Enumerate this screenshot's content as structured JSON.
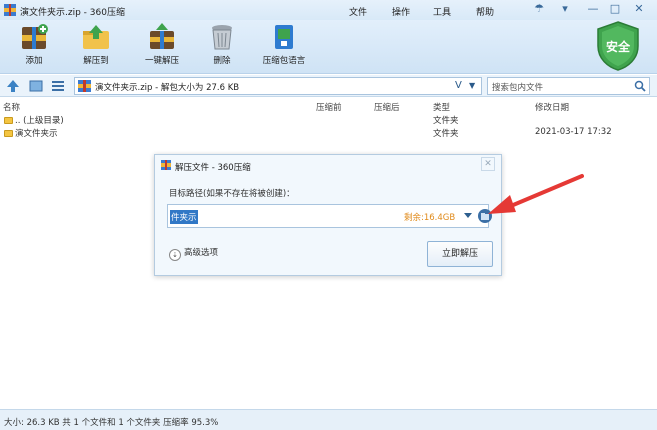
{
  "window": {
    "title": "演文件夹示.zip - 360压缩",
    "menus": [
      "文件",
      "操作",
      "工具",
      "帮助"
    ]
  },
  "toolbar": {
    "buttons": [
      {
        "label": "添加",
        "icon": "add-archive-icon"
      },
      {
        "label": "解压到",
        "icon": "extract-to-icon"
      },
      {
        "label": "一键解压",
        "icon": "one-click-extract-icon"
      },
      {
        "label": "删除",
        "icon": "trash-icon"
      },
      {
        "label": "压缩包语言",
        "icon": "archive-language-icon"
      }
    ],
    "security_badge": "安全"
  },
  "address": {
    "path": "演文件夹示.zip - 解包大小为 27.6 KB",
    "v_label": "V",
    "search_placeholder": "搜索包内文件"
  },
  "file_list": {
    "columns": [
      "名称",
      "压缩前",
      "压缩后",
      "类型",
      "修改日期"
    ],
    "rows": [
      {
        "name": ".. (上级目录)",
        "type": "文件夹",
        "date": ""
      },
      {
        "name": "演文件夹示",
        "type": "文件夹",
        "date": "2021-03-17 17:32"
      }
    ]
  },
  "dialog": {
    "title": "解压文件 - 360压缩",
    "path_label": "目标路径(如果不存在将被创建)：",
    "path_value": "件夹示",
    "free_space": "剩余:16.4GB",
    "advanced_label": "高级选项",
    "advanced_icon": "chevron-double-down-icon",
    "extract_button": "立即解压"
  },
  "status": {
    "text": "大小: 26.3 KB 共 1 个文件和 1 个文件夹 压缩率 95.3%"
  },
  "colors": {
    "accent_blue": "#3178c6",
    "free_space_orange": "#e08a1a",
    "annotation_arrow": "#e53935",
    "shield_green": "#3fa34d"
  }
}
